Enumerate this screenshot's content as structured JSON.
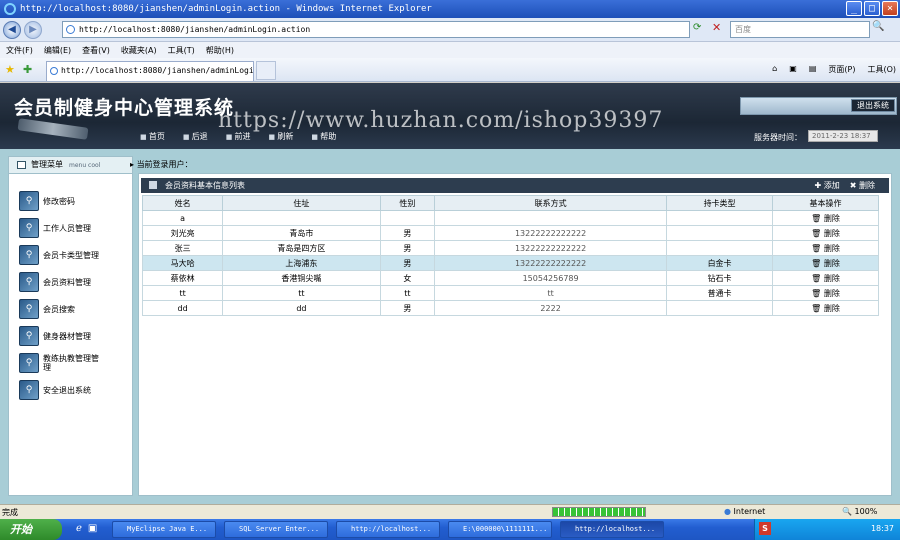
{
  "window": {
    "title": "http://localhost:8080/jianshen/adminLogin.action - Windows Internet Explorer"
  },
  "address": {
    "url": "http://localhost:8080/jianshen/adminLogin.action",
    "search_placeholder": "百度"
  },
  "menu": [
    "文件(F)",
    "编辑(E)",
    "查看(V)",
    "收藏夹(A)",
    "工具(T)",
    "帮助(H)"
  ],
  "tab": {
    "label": "http://localhost:8080/jianshen/adminLogin..."
  },
  "commandbar": {
    "page": "页面(P)",
    "tools": "工具(O)"
  },
  "site": {
    "title": "会员制健身中心管理系统",
    "logout": "退出系统",
    "nav": [
      "首页",
      "后退",
      "前进",
      "刷新",
      "帮助"
    ],
    "server_time_label": "服务器时间：",
    "server_time_value": "2011-2-23 18:37",
    "watermark": "https://www.huzhan.com/ishop39397"
  },
  "sidebar": {
    "header": "管理菜单",
    "header_small": "menu cool",
    "items": [
      "修改密码",
      "工作人员管理",
      "会员卡类型管理",
      "会员资料管理",
      "会员搜索",
      "健身器材管理",
      "教练执教管理管理",
      "安全退出系统"
    ]
  },
  "login_info": "当前登录用户：",
  "panel": {
    "title": "会员资料基本信息列表",
    "add": "添加",
    "delete": "删除"
  },
  "table": {
    "headers": [
      "姓名",
      "住址",
      "性别",
      "联系方式",
      "持卡类型",
      "基本操作"
    ],
    "delete_label": "删除",
    "rows": [
      [
        "a",
        "",
        "",
        "",
        "",
        ""
      ],
      [
        "刘光亮",
        "青岛市",
        "男",
        "13222222222222",
        "",
        ""
      ],
      [
        "张三",
        "青岛是四方区",
        "男",
        "13222222222222",
        "",
        ""
      ],
      [
        "马大哈",
        "上海浦东",
        "男",
        "13222222222222",
        "白金卡",
        ""
      ],
      [
        "蔡依林",
        "香港铜尖嘴",
        "女",
        "15054256789",
        "钻石卡",
        ""
      ],
      [
        "tt",
        "tt",
        "tt",
        "tt",
        "普通卡",
        ""
      ],
      [
        "dd",
        "dd",
        "男",
        "2222",
        "",
        ""
      ]
    ]
  },
  "status": {
    "text": "完成",
    "zone": "Internet",
    "zoom": "100%",
    "progress": 1.0
  },
  "taskbar": {
    "start": "开始",
    "items": [
      "MyEclipse Java E...",
      "SQL Server Enter...",
      "http://localhost...",
      "E:\\000000\\1111111...",
      "http://localhost..."
    ],
    "clock": "18:37",
    "tray_s": "S"
  }
}
